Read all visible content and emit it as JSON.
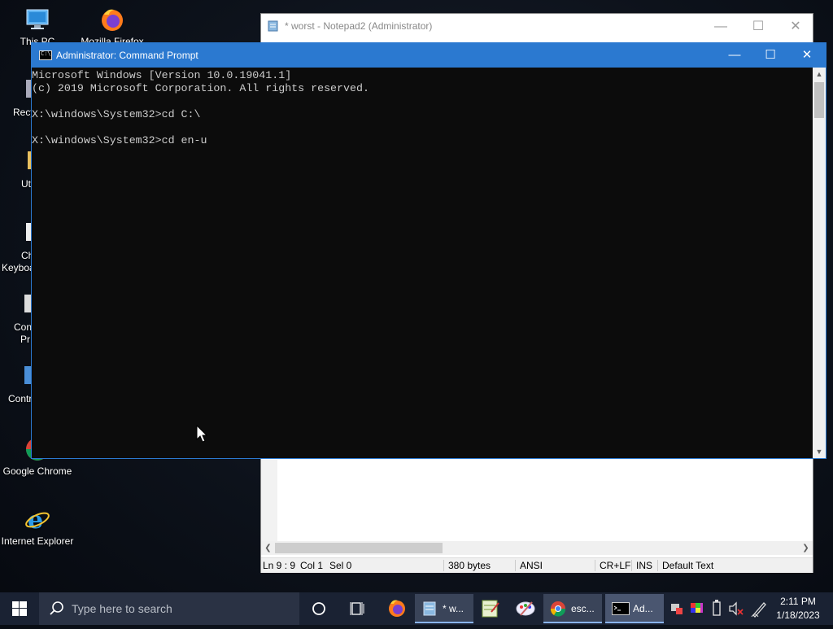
{
  "desktop": {
    "icons": [
      {
        "label": "This PC"
      },
      {
        "label": "Mozilla Firefox"
      },
      {
        "label": "Google Chrome"
      },
      {
        "label": "Internet Explorer"
      }
    ],
    "partial_labels": [
      "Recy",
      "Ut",
      "Ch",
      "Keyboa",
      "Con",
      "Pr",
      "Contr"
    ]
  },
  "notepad": {
    "title": "* worst - Notepad2 (Administrator)",
    "status": {
      "position": "Ln 9 : 9",
      "col": "Col 1",
      "sel": "Sel 0",
      "size": "380 bytes",
      "encoding": "ANSI",
      "eol": "CR+LF",
      "mode": "INS",
      "scheme": "Default Text"
    }
  },
  "cmd": {
    "title": "Administrator: Command Prompt",
    "lines": [
      "Microsoft Windows [Version 10.0.19041.1]",
      "(c) 2019 Microsoft Corporation. All rights reserved.",
      "",
      "X:\\windows\\System32>cd C:\\",
      "",
      "X:\\windows\\System32>cd en-u"
    ]
  },
  "taskbar": {
    "search_placeholder": "Type here to search",
    "apps": [
      {
        "label": "* w..."
      },
      {
        "label": "esc..."
      },
      {
        "label": "Ad..."
      }
    ],
    "time": "2:11 PM",
    "date": "1/18/2023"
  },
  "colors": {
    "cmd_titlebar": "#2b79d0",
    "cmd_background": "#0c0c0c",
    "cmd_text": "#cccccc",
    "taskbar": "#1a2233"
  }
}
